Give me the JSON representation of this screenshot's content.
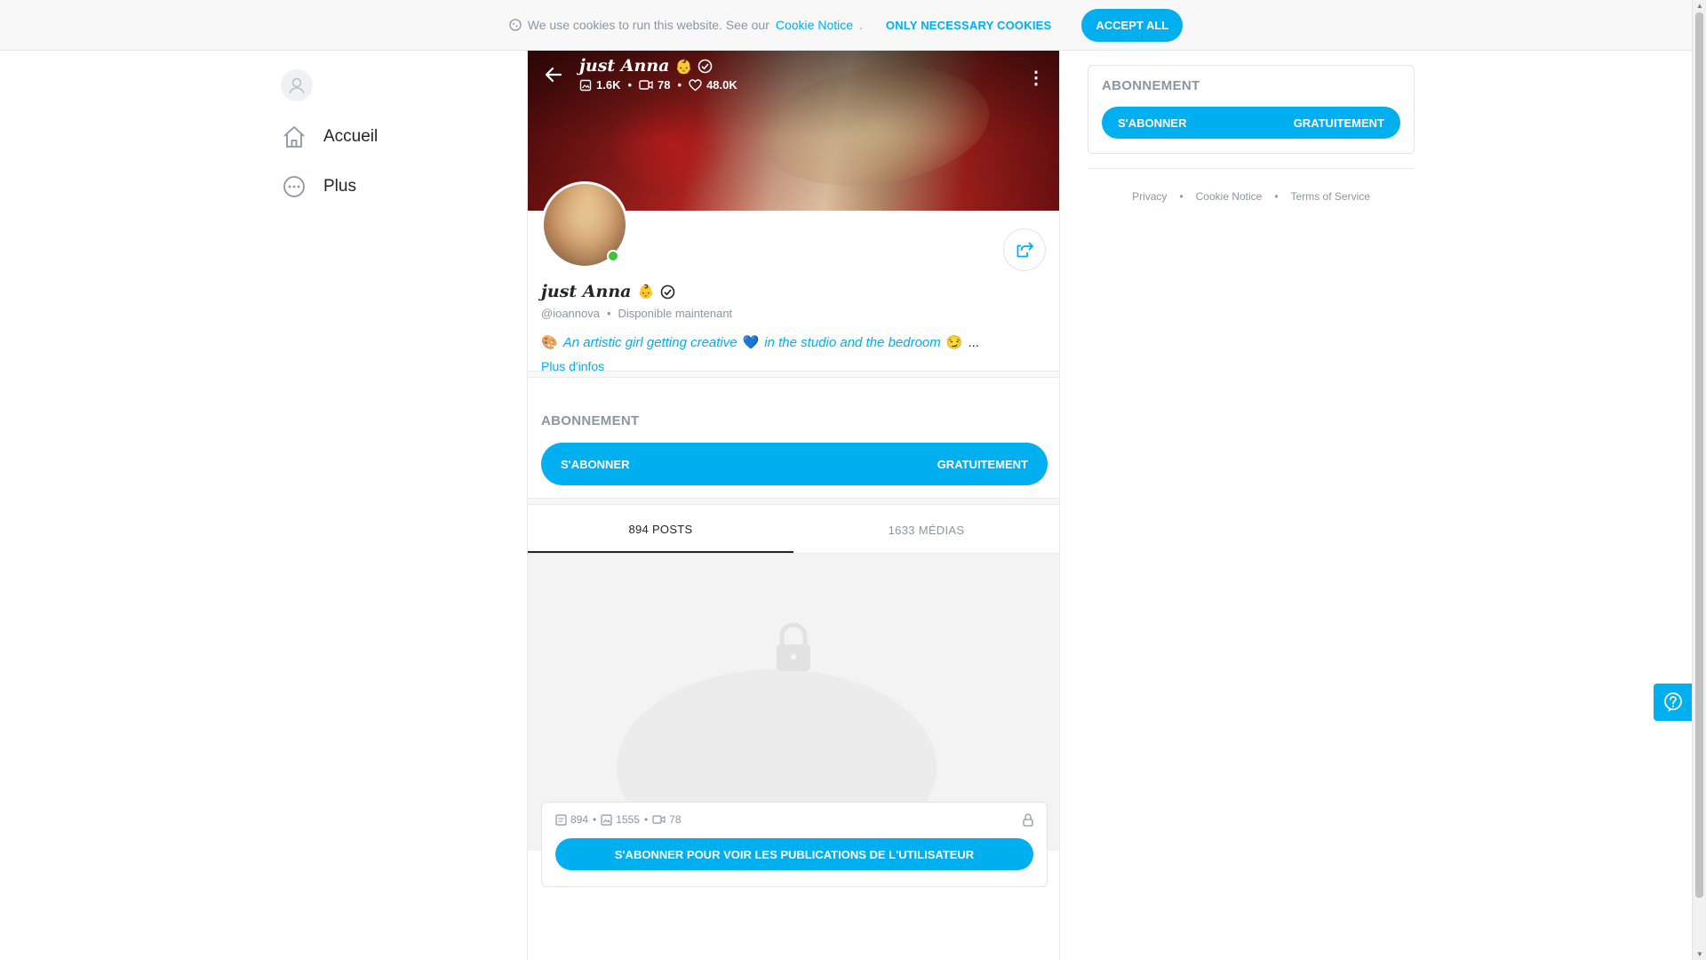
{
  "cookie_bar": {
    "message": "We use cookies to run this website. See our",
    "link": "Cookie Notice",
    "period": ".",
    "necessary_label": "ONLY NECESSARY COOKIES",
    "accept_label": "ACCEPT ALL"
  },
  "nav": {
    "items": [
      {
        "label": "Accueil",
        "icon": "home-icon"
      },
      {
        "label": "Plus",
        "icon": "more-icon"
      }
    ]
  },
  "banner": {
    "name": "just Anna",
    "emoji": "👶",
    "stats": {
      "photos": "1.6K",
      "videos": "78",
      "likes": "48.0K"
    }
  },
  "profile": {
    "name": "just Anna",
    "emoji": "👶",
    "handle": "@ioannova",
    "separator": "•",
    "status": "Disponible maintenant",
    "bio_emoji_start": "🎨",
    "bio_part1": "An artistic girl getting creative",
    "bio_heart": "💙",
    "bio_part2": "in the studio and the bedroom",
    "bio_emoji_end": "😏",
    "bio_ellipsis": "...",
    "more_info": "Plus d'infos"
  },
  "subscription": {
    "title": "ABONNEMENT",
    "button_left": "S'ABONNER",
    "button_right": "GRATUITEMENT"
  },
  "tabs": [
    {
      "label": "894 POSTS",
      "active": true
    },
    {
      "label": "1633 MÉDIAS",
      "active": false
    }
  ],
  "locked_card": {
    "posts": "894",
    "photos": "1555",
    "videos": "78",
    "dot": "•",
    "button": "S'ABONNER POUR VOIR LES PUBLICATIONS DE L'UTILISATEUR"
  },
  "right_panel": {
    "title": "ABONNEMENT",
    "button_left": "S'ABONNER",
    "button_right": "GRATUITEMENT",
    "footer": [
      "Privacy",
      "Cookie Notice",
      "Terms of Service"
    ],
    "footer_sep": "•"
  },
  "colors": {
    "accent": "#00aff0",
    "online": "#3ac537",
    "muted": "#8a96a3"
  }
}
